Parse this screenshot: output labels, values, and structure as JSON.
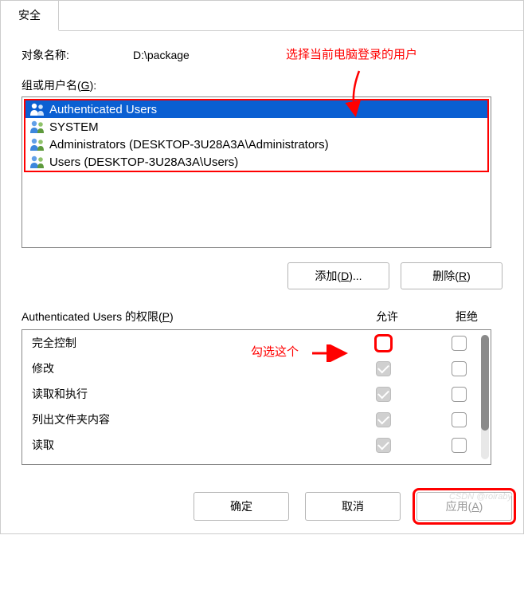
{
  "tab_label": "安全",
  "object_name_label": "对象名称:",
  "object_path": "D:\\package",
  "annotation_top": "选择当前电脑登录的用户",
  "groups_label_prefix": "组或用户名(",
  "groups_label_hotkey": "G",
  "groups_label_suffix": "):",
  "groups": [
    {
      "label": "Authenticated Users",
      "selected": true
    },
    {
      "label": "SYSTEM",
      "selected": false
    },
    {
      "label": "Administrators (DESKTOP-3U28A3A\\Administrators)",
      "selected": false
    },
    {
      "label": "Users (DESKTOP-3U28A3A\\Users)",
      "selected": false
    }
  ],
  "add_btn_prefix": "添加(",
  "add_btn_hotkey": "D",
  "add_btn_suffix": ")...",
  "remove_btn_prefix": "删除(",
  "remove_btn_hotkey": "R",
  "remove_btn_suffix": ")",
  "perm_title_prefix": "Authenticated Users 的权限(",
  "perm_title_hotkey": "P",
  "perm_title_suffix": ")",
  "col_allow": "允许",
  "col_deny": "拒绝",
  "annotation_mid": "勾选这个",
  "permissions": [
    {
      "name": "完全控制",
      "allow_checked": false,
      "allow_highlight": true,
      "deny_checked": false
    },
    {
      "name": "修改",
      "allow_checked": true,
      "allow_highlight": false,
      "deny_checked": false
    },
    {
      "name": "读取和执行",
      "allow_checked": true,
      "allow_highlight": false,
      "deny_checked": false
    },
    {
      "name": "列出文件夹内容",
      "allow_checked": true,
      "allow_highlight": false,
      "deny_checked": false
    },
    {
      "name": "读取",
      "allow_checked": true,
      "allow_highlight": false,
      "deny_checked": false
    }
  ],
  "footer": {
    "ok": "确定",
    "cancel": "取消",
    "apply_prefix": "应用(",
    "apply_hotkey": "A",
    "apply_suffix": ")"
  },
  "watermark": "CSDN @roiraby"
}
